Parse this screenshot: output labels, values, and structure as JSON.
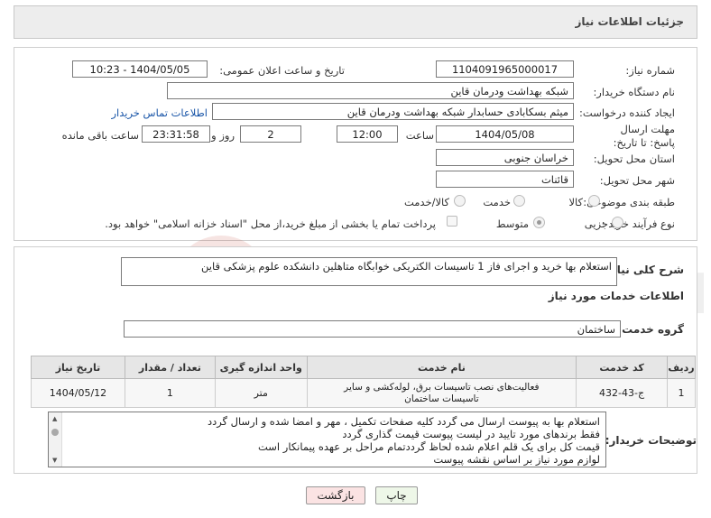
{
  "header": {
    "title": "جزئیات اطلاعات نیاز"
  },
  "fields": {
    "need_number_label": "شماره نیاز:",
    "need_number": "1104091965000017",
    "announce_label": "تاریخ و ساعت اعلان عمومی:",
    "announce_value": "1404/05/05 - 10:23",
    "buyer_org_label": "نام دستگاه خریدار:",
    "buyer_org": "شبکه بهداشت ودرمان قاین",
    "creator_label": "ایجاد کننده درخواست:",
    "creator": "میثم بسکابادی حسابدار شبکه بهداشت ودرمان قاین",
    "contact_link": "اطلاعات تماس خریدار",
    "deadline_label": "مهلت ارسال پاسخ: تا تاریخ:",
    "deadline_date": "1404/05/08",
    "time_label": "ساعت",
    "deadline_time": "12:00",
    "days_value": "2",
    "days_label": "روز و",
    "remaining_time": "23:31:58",
    "remaining_label": "ساعت باقی مانده",
    "province_label": "استان محل تحویل:",
    "province": "خراسان جنوبی",
    "city_label": "شهر محل تحویل:",
    "city": "قائنات",
    "category_label": "طبقه بندی موضوعی:",
    "category_options": [
      "کالا",
      "خدمت",
      "کالا/خدمت"
    ],
    "category_selected": "خدمت",
    "process_label": "نوع فرآیند خرید :",
    "process_options": [
      "جزیی",
      "متوسط"
    ],
    "process_selected": "متوسط",
    "payment_note": "پرداخت تمام یا بخشی از مبلغ خرید،از محل \"اسناد خزانه اسلامی\" خواهد بود."
  },
  "summary": {
    "label": "شرح کلی نیاز:",
    "text": "استعلام بها خرید و اجرای فاز 1 تاسیسات الکتریکی خوابگاه متاهلین دانشکده علوم پزشکی قاین"
  },
  "services": {
    "section_title": "اطلاعات خدمات مورد نیاز",
    "group_label": "گروه خدمت:",
    "group_value": "ساختمان",
    "columns": [
      "ردیف",
      "کد خدمت",
      "نام خدمت",
      "واحد اندازه گیری",
      "تعداد / مقدار",
      "تاریخ نیاز"
    ],
    "rows": [
      {
        "row": "1",
        "code": "ج-43-432",
        "name": "فعالیت‌های نصب تاسیسات برق، لوله‌کشی و سایر تاسیسات ساختمان",
        "unit": "متر",
        "qty": "1",
        "date": "1404/05/12"
      }
    ]
  },
  "buyer_notes": {
    "label": "توضیحات خریدار:",
    "lines": [
      "استعلام بها به پیوست ارسال می گردد کلیه صفحات تکمیل ، مهر و امضا شده و ارسال گردد",
      "فقط برندهای مورد تایید در لیست پیوست قیمت گذاری گردد",
      "قیمت کل برای یک قلم اعلام شده لحاظ گرددتمام مراحل بر عهده پیمانکار است",
      "لوازم مورد نیاز بر اساس نقشه پیوست"
    ]
  },
  "buttons": {
    "print": "چاپ",
    "back": "بازگشت"
  },
  "watermark": "AriaTender.net",
  "colors": {
    "link": "#1a56a8",
    "back_button": "#fbe3e3",
    "print_button": "#eef7e8",
    "watermark": "#c0392b"
  }
}
